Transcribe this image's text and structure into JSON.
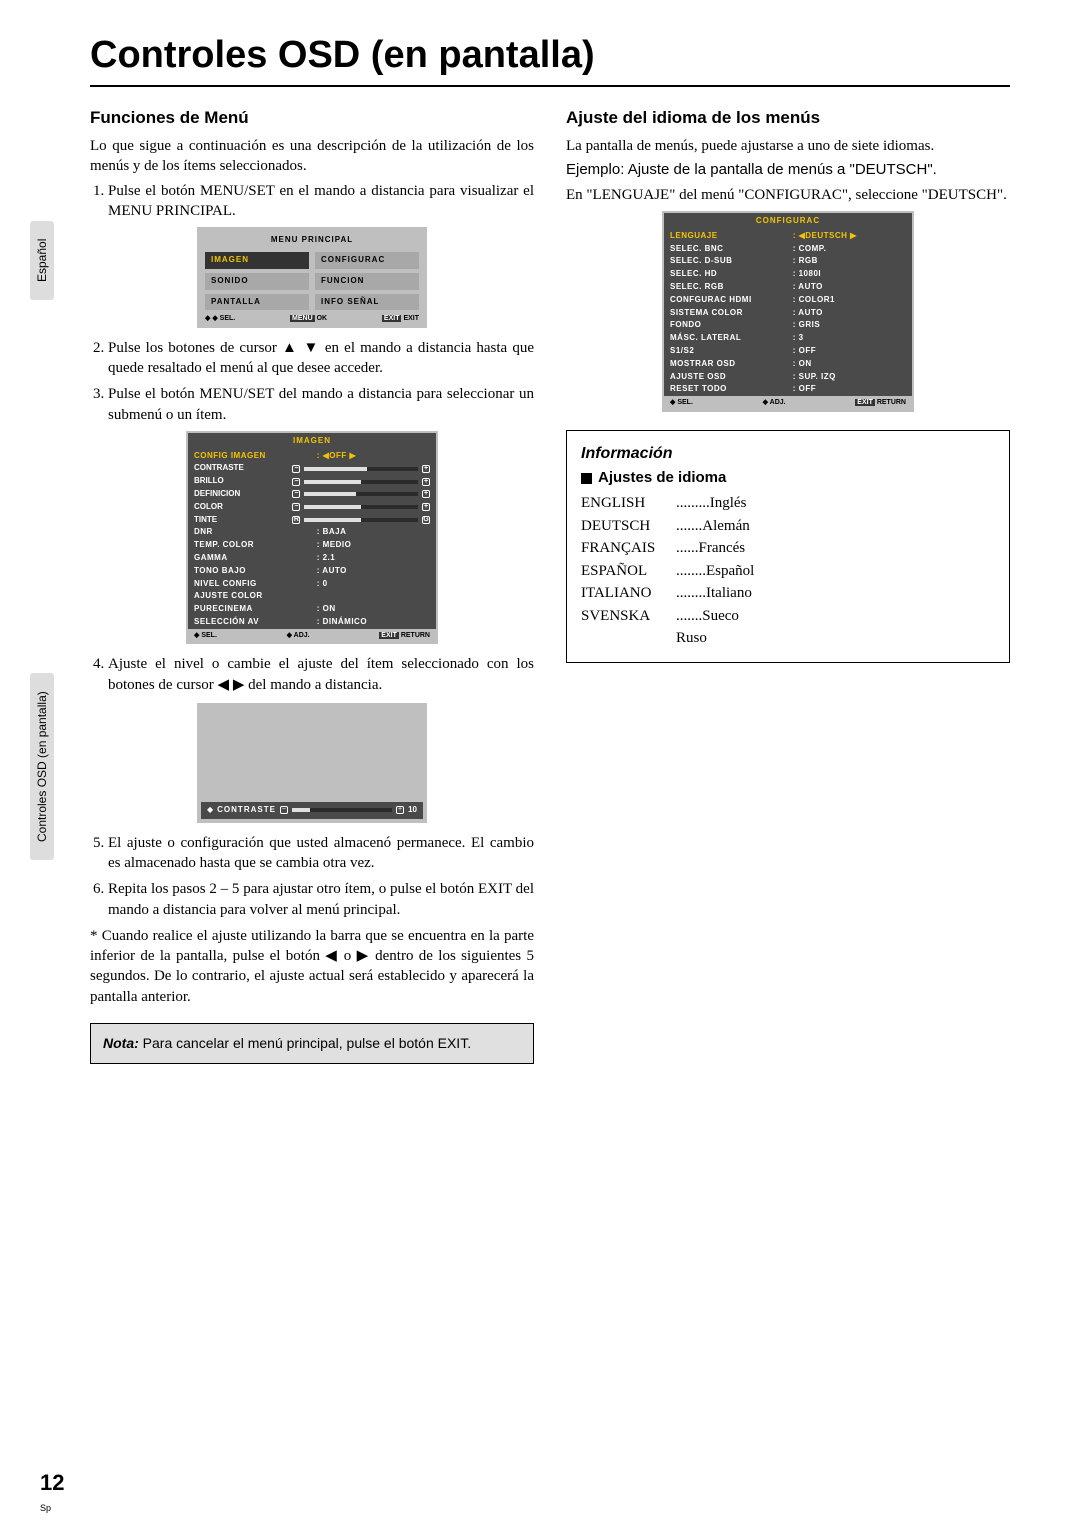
{
  "title": "Controles OSD (en pantalla)",
  "sideTabLang": "Español",
  "sideTabSection": "Controles OSD (en pantalla)",
  "pageNumber": "12",
  "spMark": "Sp",
  "left": {
    "heading": "Funciones de Menú",
    "intro": "Lo que sigue a continuación es una descripción de la utilización de los menús y de los ítems seleccionados.",
    "step1": "Pulse el botón MENU/SET en el mando a distancia para visualizar el MENU PRINCIPAL.",
    "step2": "Pulse los botones de cursor ▲ ▼ en el mando a distancia hasta que quede resaltado el menú al que desee acceder.",
    "step3": "Pulse el botón MENU/SET del mando a distancia para seleccionar un submenú o un ítem.",
    "step4": "Ajuste el nivel o cambie el ajuste del ítem seleccionado con los botones de cursor ◀ ▶ del mando a distancia.",
    "step5": "El ajuste o configuración que usted almacenó permanece. El cambio es almacenado hasta que se cambia otra vez.",
    "step6": "Repita los pasos 2 – 5 para ajustar otro ítem, o pulse el botón EXIT del mando a distancia para volver al menú principal.",
    "star": "Cuando realice el ajuste utilizando la barra que se encuentra en la parte inferior de la pantalla, pulse el botón ◀ o ▶ dentro de los siguientes 5 segundos. De lo contrario, el ajuste actual será establecido y aparecerá la pantalla anterior.",
    "noteLabel": "Nota:",
    "noteText": "Para cancelar el menú principal, pulse el botón EXIT."
  },
  "right": {
    "heading": "Ajuste del idioma de los menús",
    "p1": "La pantalla de menús, puede ajustarse a uno de siete idiomas.",
    "p2": "Ejemplo: Ajuste de la pantalla de menús a \"DEUTSCH\".",
    "p3": "En \"LENGUAJE\" del menú \"CONFIGURAC\", seleccione \"DEUTSCH\".",
    "infoHeading": "Información",
    "infoSub": "Ajustes de idioma",
    "langs": [
      {
        "code": "ENGLISH",
        "dots": ".........",
        "name": "Inglés"
      },
      {
        "code": "DEUTSCH",
        "dots": ".......",
        "name": "Alemán"
      },
      {
        "code": "FRANÇAIS",
        "dots": "......",
        "name": "Francés"
      },
      {
        "code": "ESPAÑOL",
        "dots": "........",
        "name": "Español"
      },
      {
        "code": "ITALIANO",
        "dots": "........",
        "name": "Italiano"
      },
      {
        "code": "SVENSKA",
        "dots": ".......",
        "name": "Sueco"
      },
      {
        "code": "",
        "dots": "",
        "name": "Ruso"
      }
    ]
  },
  "osdMain": {
    "title": "MENU PRINCIPAL",
    "cells": [
      {
        "text": "IMAGEN",
        "hl": true
      },
      {
        "text": "CONFIGURAC",
        "light": true
      },
      {
        "text": "SONIDO",
        "light": true
      },
      {
        "text": "FUNCION",
        "light": true
      },
      {
        "text": "PANTALLA",
        "light": true
      },
      {
        "text": "INFO SEÑAL",
        "light": true
      }
    ],
    "foot_sel": "◆ ◆ SEL.",
    "foot_ok": "MENU OK",
    "foot_exit": "EXIT EXIT"
  },
  "osdImagen": {
    "title": "IMAGEN",
    "topRow": {
      "k": "CONFIG IMAGEN",
      "v": ": ◀OFF ▶"
    },
    "sliders": [
      {
        "k": "CONTRASTE",
        "fill": 55
      },
      {
        "k": "BRILLO",
        "fill": 50
      },
      {
        "k": "DEFINICION",
        "fill": 45
      },
      {
        "k": "COLOR",
        "fill": 50
      },
      {
        "k": "TINTE",
        "fill": 50,
        "rg": true
      }
    ],
    "rows": [
      {
        "k": "DNR",
        "v": ": BAJA"
      },
      {
        "k": "TEMP. COLOR",
        "v": ": MEDIO"
      },
      {
        "k": "GAMMA",
        "v": ": 2.1"
      },
      {
        "k": "TONO BAJO",
        "v": ": AUTO"
      },
      {
        "k": "NIVEL CONFIG",
        "v": ": 0"
      },
      {
        "k": "AJUSTE COLOR",
        "v": ""
      },
      {
        "k": "PURECINEMA",
        "v": ": ON"
      },
      {
        "k": "SELECCIÓN AV",
        "v": ": DINÁMICO"
      }
    ],
    "foot_sel": "◆ SEL.",
    "foot_adj": "◆ ADJ.",
    "foot_exit": "EXIT RETURN"
  },
  "osdContrast": {
    "label": "CONTRASTE",
    "value": "10"
  },
  "osdConfig": {
    "title": "CONFIGURAC",
    "rows": [
      {
        "k": "LENGUAJE",
        "v": ": ◀DEUTSCH ▶",
        "hl": true
      },
      {
        "k": "SELEC. BNC",
        "v": ": COMP."
      },
      {
        "k": "SELEC. D-SUB",
        "v": ": RGB"
      },
      {
        "k": "SELEC. HD",
        "v": ": 1080I"
      },
      {
        "k": "SELEC. RGB",
        "v": ": AUTO"
      },
      {
        "k": "CONFGURAC HDMI",
        "v": ": COLOR1"
      },
      {
        "k": "SISTEMA COLOR",
        "v": ": AUTO"
      },
      {
        "k": "FONDO",
        "v": ": GRIS"
      },
      {
        "k": "MÁSC. LATERAL",
        "v": ": 3"
      },
      {
        "k": "S1/S2",
        "v": ": OFF"
      },
      {
        "k": "MOSTRAR OSD",
        "v": ": ON"
      },
      {
        "k": "AJUSTE OSD",
        "v": ": SUP. IZQ"
      },
      {
        "k": "RESET TODO",
        "v": ": OFF"
      }
    ],
    "foot_sel": "◆ SEL.",
    "foot_adj": "◆ ADJ.",
    "foot_exit": "EXIT RETURN"
  }
}
